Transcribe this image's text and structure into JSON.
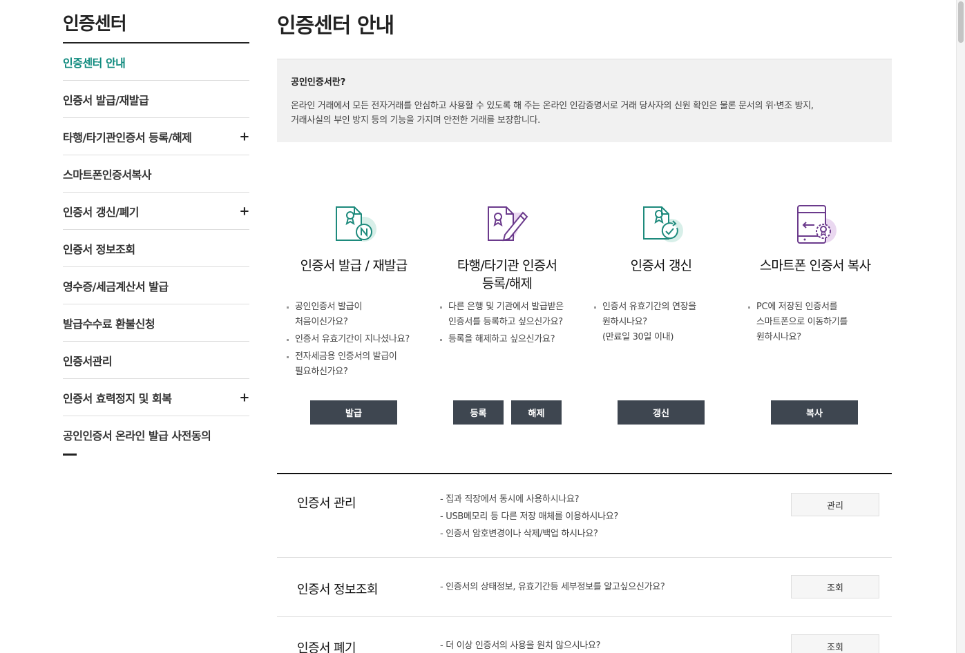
{
  "sidebar": {
    "title": "인증센터",
    "items": [
      {
        "label": "인증센터 안내",
        "plus": ""
      },
      {
        "label": "인증서 발급/재발급",
        "plus": ""
      },
      {
        "label": "타행/타기관인증서 등록/해제",
        "plus": "+"
      },
      {
        "label": "스마트폰인증서복사",
        "plus": ""
      },
      {
        "label": "인증서 갱신/폐기",
        "plus": "+"
      },
      {
        "label": "인증서 정보조회",
        "plus": ""
      },
      {
        "label": "영수증/세금계산서 발급",
        "plus": ""
      },
      {
        "label": "발급수수료 환불신청",
        "plus": ""
      },
      {
        "label": "인증서관리",
        "plus": ""
      },
      {
        "label": "인증서 효력정지 및 회복",
        "plus": "+"
      },
      {
        "label": "공인인증서 온라인 발급 사전동의",
        "plus": ""
      }
    ]
  },
  "main": {
    "title": "인증센터 안내",
    "info": {
      "question": "공인인증서란?",
      "line1": "온라인 거래에서 모든 전자거래를 안심하고 사용할 수 있도록 해 주는 온라인 인감증명서로 거래 당사자의 신원 확인은 물론 문서의 위·변조 방지,",
      "line2": "거래사실의 부인 방지 등의 기능을 가지며 안전한 거래를 보장합니다."
    },
    "cards": [
      {
        "icon": "certificate-new-icon",
        "title1": "인증서 발급 / 재발급",
        "title2": "",
        "bullets": [
          "공인인증서 발급이",
          "처음이신가요?",
          "인증서 유효기간이 지나셨나요?",
          "전자세금용 인증서의 발급이",
          "필요하신가요?"
        ],
        "button1": "발급"
      },
      {
        "icon": "certificate-edit-icon",
        "title1": "타행/타기관 인증서",
        "title2": "등록/해제",
        "bullets": [
          "다른 은행 및 기관에서 발급받은",
          "인증서를 등록하고 싶으신가요?",
          "등록을 해제하고 싶으신가요?"
        ],
        "button1": "등록",
        "button2": "해제"
      },
      {
        "icon": "certificate-renew-icon",
        "title1": "인증서 갱신",
        "title2": "",
        "bullets": [
          "인증서 유효기간의 연장을",
          "원하시나요?",
          "(만료일 30일 이내)"
        ],
        "button1": "갱신"
      },
      {
        "icon": "smartphone-copy-icon",
        "title1": "스마트폰 인증서 복사",
        "title2": "",
        "bullets": [
          "PC에 저장된 인증서를",
          "스마트폰으로 이동하기를",
          "원하시나요?"
        ],
        "button1": "복사"
      }
    ],
    "rows": [
      {
        "title": "인증서 관리",
        "lines": [
          "- 집과 직장에서 동시에 사용하시나요?",
          "- USB메모리 등 다른 저장 매체를 이용하시나요?",
          "- 인증서 암호변경이나 삭제/백업 하시나요?"
        ],
        "button": "관리"
      },
      {
        "title": "인증서 정보조회",
        "lines": [
          "- 인증서의 상태정보, 유효기간등 세부정보를 알고싶으신가요?"
        ],
        "button": "조회"
      },
      {
        "title": "인증서 폐기",
        "lines": [
          "- 더 이상 인증서의 사용을 원치 않으시나요?"
        ],
        "button": "조회"
      }
    ]
  },
  "colors": {
    "accent": "#0f8a7e",
    "button_dark": "#3e4650",
    "info_bg": "#f1f1f1",
    "icon_teal": "#1d8a7c",
    "icon_purple": "#6b3a8c"
  }
}
